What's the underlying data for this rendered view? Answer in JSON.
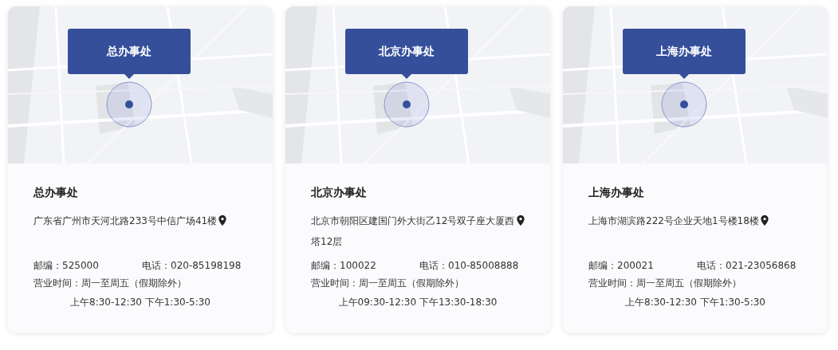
{
  "offices": [
    {
      "callout": "总办事处",
      "name": "总办事处",
      "address": "广东省广州市天河北路233号中信广场41楼",
      "postal_code": "邮编：525000",
      "phone": "电话：020-85198198",
      "hours_label": "营业时间：周一至周五（假期除外）",
      "hours": "上午8:30-12:30 下午1:30-5:30"
    },
    {
      "callout": "北京办事处",
      "name": "北京办事处",
      "address": "北京市朝阳区建国门外大街乙12号双子座大厦西塔12层",
      "postal_code": "邮编：100022",
      "phone": "电话：010-85008888",
      "hours_label": "营业时间：周一至周五（假期除外）",
      "hours": "上午09:30-12:30 下午13:30-18:30"
    },
    {
      "callout": "上海办事处",
      "name": "上海办事处",
      "address": "上海市湖滨路222号企业天地1号楼18楼",
      "postal_code": "邮编：200021",
      "phone": "电话：021-23056868",
      "hours_label": "营业时间：周一至周五（假期除外）",
      "hours": "上午8:30-12:30 下午1:30-5:30"
    }
  ]
}
